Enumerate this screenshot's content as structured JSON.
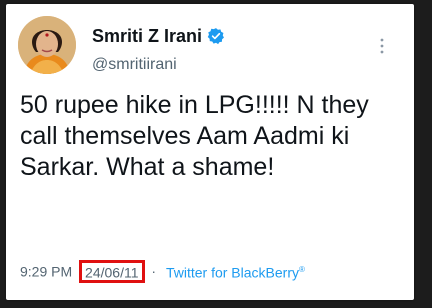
{
  "tweet": {
    "display_name": "Smriti Z Irani",
    "handle": "@smritiirani",
    "text": "50 rupee hike in LPG!!!!! N they call themselves Aam Aadmi ki Sarkar. What a shame!",
    "time": "9:29 PM",
    "separator": "·",
    "date": "24/06/11",
    "source": "Twitter for BlackBerry",
    "source_mark": "®",
    "icons": [
      "avatar",
      "verified-badge-icon",
      "more-options-icon"
    ]
  },
  "colors": {
    "text": "#0f1419",
    "secondary": "#536471",
    "accent": "#1d9bf0",
    "highlight_box": "#e01010"
  }
}
